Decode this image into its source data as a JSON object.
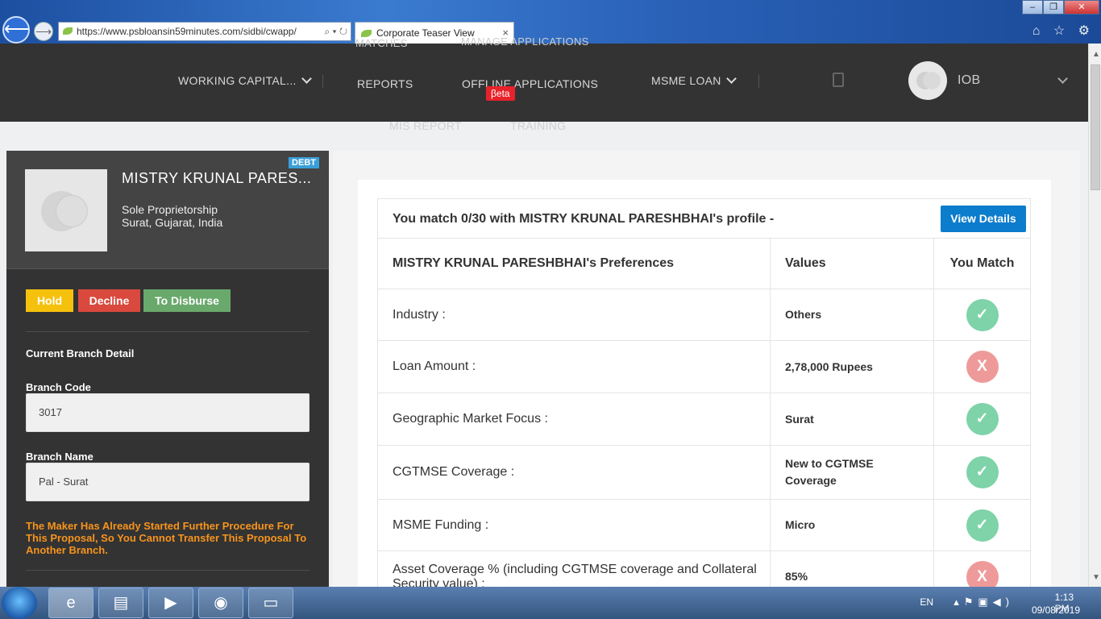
{
  "browser": {
    "url": "https://www.psbloansin59minutes.com/sidbi/cwapp/",
    "tab_title": "Corporate Teaser View",
    "tab_close": "×",
    "back": "⟵",
    "forward": "⟶",
    "url_tools": "⌕ ▾ ↻",
    "icons": "⌂ ☆ ⚙",
    "window_buttons": [
      "–",
      "❐",
      "✕"
    ]
  },
  "nav": {
    "items": [
      {
        "label": "WORKING CAPITAL..."
      },
      {
        "label": "REPORTS"
      },
      {
        "label": "OFFLINE APPLICATIONS"
      },
      {
        "label": "MSME LOAN"
      }
    ],
    "overflow_top": [
      "MATCHES",
      "MANAGE APPLICATIONS"
    ],
    "overflow_bottom": [
      "MIS REPORT",
      "TRAINING"
    ],
    "beta_badge": "βeta",
    "user": "IOB"
  },
  "sidebar": {
    "badge": "DEBT",
    "company_name": "MISTRY KRUNAL PARES...",
    "company_type": "Sole Proprietorship",
    "location": "Surat, Gujarat, India",
    "buttons": {
      "hold": "Hold",
      "decline": "Decline",
      "disburse": "To Disburse"
    },
    "branch_title": "Current Branch Detail",
    "branch_code_label": "Branch Code",
    "branch_code": "3017",
    "branch_name_label": "Branch Name",
    "branch_name": "Pal - Surat",
    "warning": "The Maker Has Already Started Further Procedure For This Proposal, So You Cannot Transfer This Proposal To Another Branch."
  },
  "match": {
    "header": "You match 0/30 with MISTRY KRUNAL PARESHBHAI's profile -",
    "view_details": "View Details",
    "columns": [
      "MISTRY KRUNAL PARESHBHAI's Preferences",
      "Values",
      "You Match"
    ],
    "rows": [
      {
        "pref": "Industry :",
        "value": "Others",
        "match": true,
        "icon": "✓"
      },
      {
        "pref": "Loan Amount :",
        "value": "2,78,000 Rupees",
        "match": false,
        "icon": "X"
      },
      {
        "pref": "Geographic Market Focus :",
        "value": "Surat",
        "match": true,
        "icon": "✓"
      },
      {
        "pref": "CGTMSE Coverage :",
        "value": "New to CGTMSE Coverage",
        "match": true,
        "icon": "✓"
      },
      {
        "pref": "MSME Funding :",
        "value": "Micro",
        "match": true,
        "icon": "✓"
      },
      {
        "pref": "Asset Coverage % (including CGTMSE coverage and Collateral Security value) :",
        "value": "85%",
        "match": false,
        "icon": "X"
      }
    ]
  },
  "taskbar": {
    "lang": "EN",
    "time": "1:13 PM",
    "date": "09/08/2019"
  },
  "colors": {
    "accent": "#0c7ccc",
    "match": "#7ed3a8",
    "nomatch": "#ef9a9a",
    "warning": "#f7941d"
  }
}
